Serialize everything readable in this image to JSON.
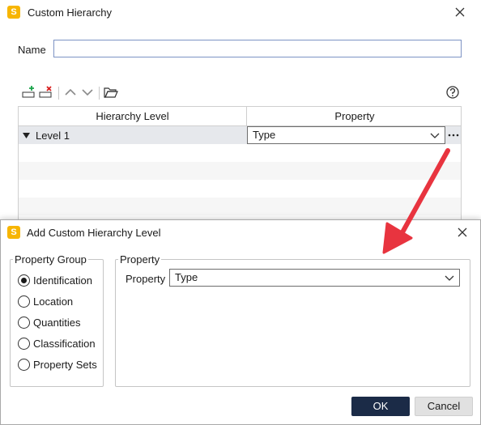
{
  "back_dialog": {
    "title": "Custom Hierarchy",
    "name_label": "Name",
    "name_value": "",
    "grid": {
      "columns": [
        "Hierarchy Level",
        "Property"
      ],
      "rows": [
        {
          "level": "Level 1",
          "property": "Type"
        }
      ]
    },
    "toolbar": {
      "add_icon": "add-level-icon",
      "remove_icon": "remove-level-icon",
      "up_icon": "arrow-up-icon",
      "down_icon": "arrow-down-icon",
      "open_icon": "folder-open-icon",
      "help_icon": "help-icon"
    }
  },
  "front_dialog": {
    "title": "Add Custom Hierarchy Level",
    "property_group_title": "Property Group",
    "property_groups": [
      {
        "label": "Identification",
        "checked": true
      },
      {
        "label": "Location",
        "checked": false
      },
      {
        "label": "Quantities",
        "checked": false
      },
      {
        "label": "Classification",
        "checked": false
      },
      {
        "label": "Property Sets",
        "checked": false
      }
    ],
    "property_title": "Property",
    "property_label": "Property",
    "property_value": "Type",
    "ok_label": "OK",
    "cancel_label": "Cancel"
  },
  "colors": {
    "accent_dark": "#1b2b47",
    "app_icon": "#f7b500",
    "arrow": "#e8343f"
  }
}
